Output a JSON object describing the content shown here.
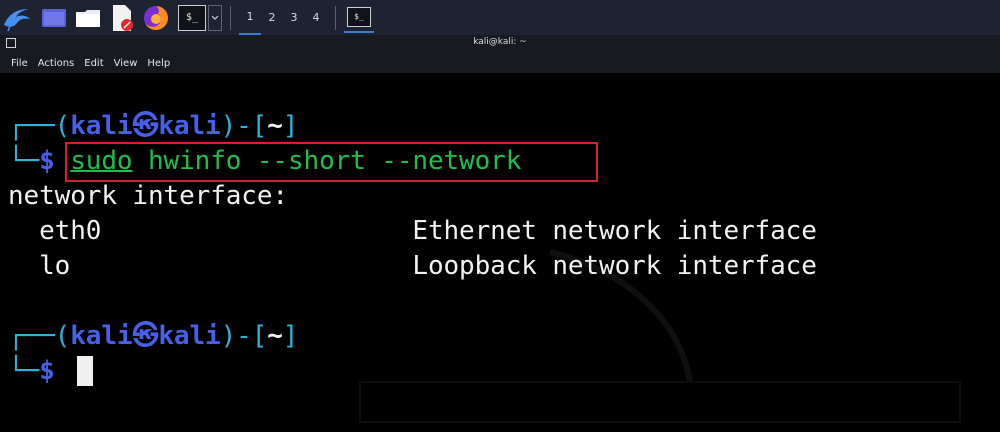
{
  "panel": {
    "workspaces": [
      "1",
      "2",
      "3",
      "4"
    ],
    "active_workspace": "1"
  },
  "window": {
    "title": "kali@kali: ~"
  },
  "menu": [
    "File",
    "Actions",
    "Edit",
    "View",
    "Help"
  ],
  "terminal": {
    "prompt1": {
      "user": "kali",
      "host": "kali",
      "dir": "~"
    },
    "command": {
      "sudo": "sudo",
      "rest": " hwinfo --short --network"
    },
    "output": [
      "network interface:",
      "  eth0                    Ethernet network interface",
      "  lo                      Loopback network interface"
    ],
    "prompt2": {
      "user": "kali",
      "host": "kali",
      "dir": "~"
    }
  },
  "colors": {
    "prompt_user": "#4660e8",
    "prompt_bracket": "#2bb5d6",
    "command": "#1fbf4e",
    "highlight_box": "#d8202b"
  },
  "icons": [
    "kali-dragon-icon",
    "files-icon",
    "folder-icon",
    "text-editor-icon",
    "firefox-icon",
    "terminal-icon"
  ]
}
